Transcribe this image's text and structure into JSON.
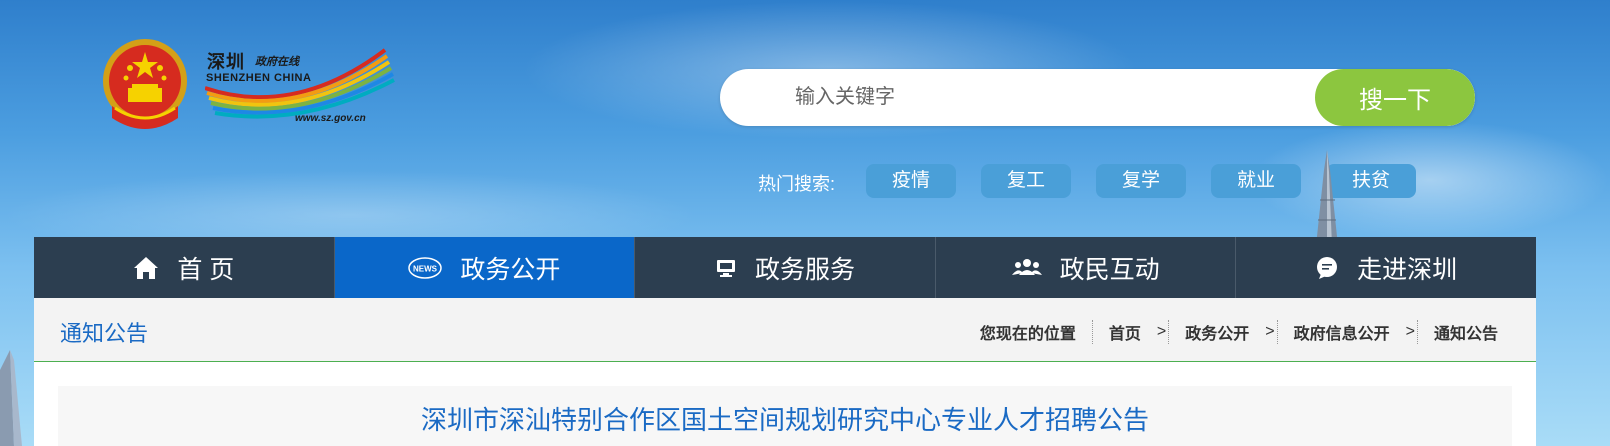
{
  "header": {
    "logo": {
      "cn_name": "深圳",
      "cn_sub": "政府在线",
      "en_name": "SHENZHEN CHINA",
      "url": "www.sz.gov.cn"
    },
    "emblem_icon": "national-emblem-icon"
  },
  "search": {
    "placeholder": "输入关键字",
    "button_label": "搜一下",
    "button_color": "#8cc63f"
  },
  "hot_search": {
    "label": "热门搜索:",
    "tags": [
      "疫情",
      "复工",
      "复学",
      "就业",
      "扶贫"
    ]
  },
  "nav": {
    "active_color": "#0a67c9",
    "bar_color": "#2c3e50",
    "items": [
      {
        "label": "首 页",
        "icon": "home-icon"
      },
      {
        "label": "政务公开",
        "icon": "news-icon",
        "icon_text": "NEWS"
      },
      {
        "label": "政务服务",
        "icon": "monitor-icon"
      },
      {
        "label": "政民互动",
        "icon": "users-icon"
      },
      {
        "label": "走进深圳",
        "icon": "chat-bubble-icon"
      }
    ]
  },
  "section": {
    "title": "通知公告"
  },
  "breadcrumb": {
    "prefix": "您现在的位置",
    "items": [
      "首页",
      "政务公开",
      "政府信息公开",
      "通知公告"
    ]
  },
  "article": {
    "title": "深圳市深汕特别合作区国土空间规划研究中心专业人才招聘公告"
  }
}
